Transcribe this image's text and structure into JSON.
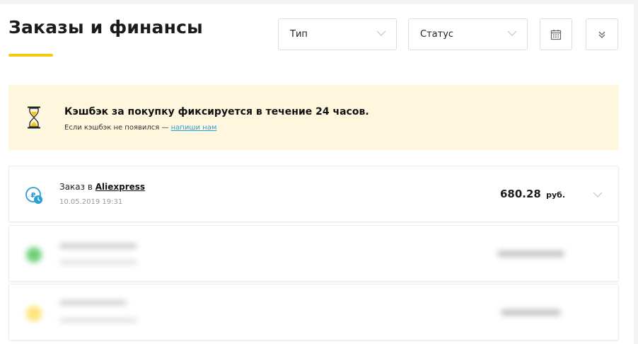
{
  "header": {
    "title": "Заказы и финансы",
    "accent_color": "#f6c90e"
  },
  "filters": {
    "type_label": "Тип",
    "status_label": "Статус",
    "calendar_icon": "calendar-icon",
    "expand_icon": "double-chevron-down-icon"
  },
  "notice": {
    "icon": "hourglass-icon",
    "title": "Кэшбэк за покупку фиксируется в течение 24 часов.",
    "subtitle_prefix": "Если кэшбэк не появился — ",
    "link_text": "напиши нам",
    "background": "#fff6de",
    "link_color": "#2a9fd6"
  },
  "orders": [
    {
      "title_prefix": "Заказ в ",
      "store": "Aliexpress",
      "date": "10.05.2019 19:31",
      "amount": "680.28",
      "currency": "руб.",
      "icon": "cashback-clock-icon"
    }
  ],
  "blurred_rows": [
    {
      "dot_color": "#6ed07a"
    },
    {
      "dot_color": "#ffe37a"
    }
  ]
}
